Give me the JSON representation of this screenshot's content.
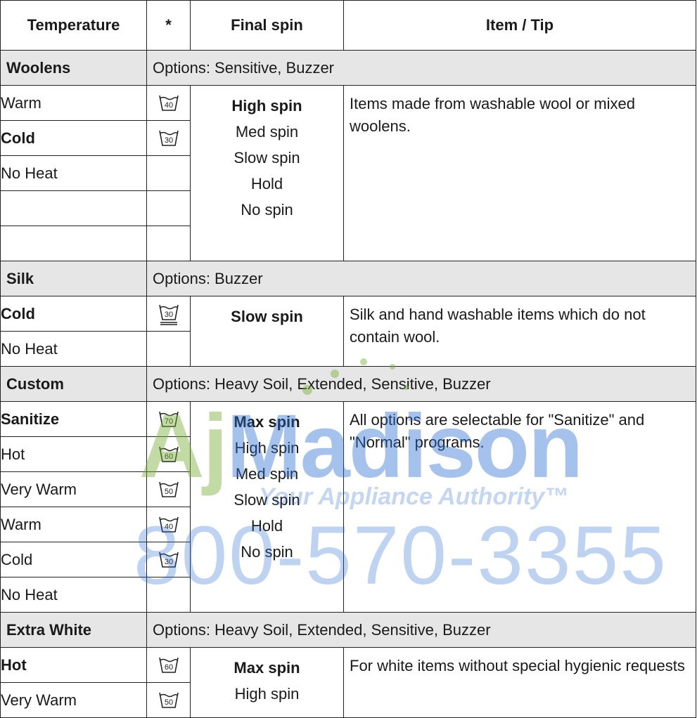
{
  "headers": {
    "temperature": "Temperature",
    "symbol": "*",
    "final_spin": "Final spin",
    "item_tip": "Item / Tip"
  },
  "sections": [
    {
      "name": "Woolens",
      "options": "Options: Sensitive, Buzzer",
      "rows": [
        {
          "temp": "Warm",
          "bold": false,
          "symbol": "40",
          "symbol_style": "plain"
        },
        {
          "temp": "Cold",
          "bold": true,
          "symbol": "30",
          "symbol_style": "plain"
        },
        {
          "temp": "No Heat",
          "bold": false,
          "symbol": ""
        },
        {
          "temp": "",
          "bold": false,
          "symbol": ""
        },
        {
          "temp": "",
          "bold": false,
          "symbol": ""
        }
      ],
      "spins": [
        {
          "t": "High spin",
          "b": true
        },
        {
          "t": "Med spin",
          "b": false
        },
        {
          "t": "Slow spin",
          "b": false
        },
        {
          "t": "Hold",
          "b": false
        },
        {
          "t": "No spin",
          "b": false
        }
      ],
      "tip": "Items made from washable wool or mixed woolens."
    },
    {
      "name": "Silk",
      "options": "Options: Buzzer",
      "rows": [
        {
          "temp": "Cold",
          "bold": true,
          "symbol": "30",
          "symbol_style": "underlined"
        },
        {
          "temp": "No Heat",
          "bold": false,
          "symbol": ""
        }
      ],
      "spins": [
        {
          "t": "Slow spin",
          "b": true
        }
      ],
      "tip": "Silk and hand washable items which do not contain wool."
    },
    {
      "name": "Custom",
      "options": "Options: Heavy Soil, Extended, Sensitive, Buzzer",
      "rows": [
        {
          "temp": "Sanitize",
          "bold": true,
          "symbol": "70",
          "symbol_style": "plain"
        },
        {
          "temp": "Hot",
          "bold": false,
          "symbol": "60",
          "symbol_style": "plain"
        },
        {
          "temp": "Very Warm",
          "bold": false,
          "symbol": "50",
          "symbol_style": "plain"
        },
        {
          "temp": "Warm",
          "bold": false,
          "symbol": "40",
          "symbol_style": "plain"
        },
        {
          "temp": "Cold",
          "bold": false,
          "symbol": "30",
          "symbol_style": "plain"
        },
        {
          "temp": "No Heat",
          "bold": false,
          "symbol": ""
        }
      ],
      "spins": [
        {
          "t": "Max spin",
          "b": true
        },
        {
          "t": "High spin",
          "b": false
        },
        {
          "t": "Med spin",
          "b": false
        },
        {
          "t": "Slow spin",
          "b": false
        },
        {
          "t": "Hold",
          "b": false
        },
        {
          "t": "No spin",
          "b": false
        }
      ],
      "tip": "All options are selectable for \"Sanitize\" and \"Normal\" programs."
    },
    {
      "name": "Extra White",
      "options": "Options: Heavy Soil, Extended, Sensitive, Buzzer",
      "rows": [
        {
          "temp": "Hot",
          "bold": true,
          "symbol": "60",
          "symbol_style": "plain"
        },
        {
          "temp": "Very Warm",
          "bold": false,
          "symbol": "50",
          "symbol_style": "plain"
        }
      ],
      "spins": [
        {
          "t": "Max spin",
          "b": true
        },
        {
          "t": "High spin",
          "b": false
        }
      ],
      "tip": "For white items without special hygienic requests"
    }
  ],
  "watermark": {
    "logo_a": "Aj",
    "logo_b": "Madison",
    "tagline": "Your Appliance Authority™",
    "phone": "800-570-3355"
  }
}
